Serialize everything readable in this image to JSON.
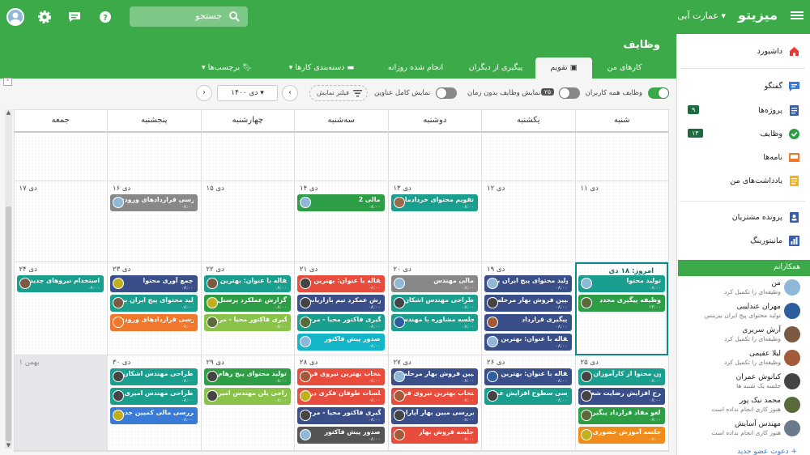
{
  "topbar": {
    "brand": "میزیتو",
    "workspace": "عمارت آبی",
    "search_placeholder": "جستجو"
  },
  "sidebar": {
    "items": [
      {
        "label": "داشبورد",
        "icon": "home-icon",
        "color": "#e53935"
      },
      {
        "label": "گفتگو",
        "icon": "chat-icon",
        "color": "#3a7bd5"
      },
      {
        "label": "پروژه‌ها",
        "icon": "projects-icon",
        "color": "#3a5fa8",
        "badge": "۹"
      },
      {
        "label": "وظایف",
        "icon": "tasks-icon",
        "color": "#2e9e46",
        "badge": "۱۳"
      },
      {
        "label": "نامه‌ها",
        "icon": "mail-icon",
        "color": "#f0772b"
      },
      {
        "label": "یادداشت‌های من",
        "icon": "notes-icon",
        "color": "#f3b21c"
      },
      {
        "label": "پرونده مشتریان",
        "icon": "customers-icon",
        "color": "#3a5fa8"
      },
      {
        "label": "مانیتورینگ",
        "icon": "monitoring-icon",
        "color": "#3a5fa8"
      }
    ],
    "colleagues_header": "همکارانم",
    "colleagues": [
      {
        "name": "من",
        "status": "وظیفه‌ای را تکمیل کرد",
        "color": "#8fb8d8"
      },
      {
        "name": "مهران عندلیبی",
        "status": "تولید محتوای پیج ایران بیزینس",
        "color": "#2d5e9e"
      },
      {
        "name": "آرش سریری",
        "status": "وظیفه‌ای را تکمیل کرد",
        "color": "#7a5a40"
      },
      {
        "name": "لیلا عقیمی",
        "status": "وظیفه‌ای را تکمیل کرد",
        "color": "#a35a3a"
      },
      {
        "name": "کیانوش عمران",
        "status": "جلسه یک شنبه ها",
        "color": "#444"
      },
      {
        "name": "محمد نیک پور",
        "status": "هنوز کاری انجام نداده است",
        "color": "#5a6a3a"
      },
      {
        "name": "مهندس آسایش",
        "status": "هنوز کاری انجام نداده است",
        "color": "#6a7a8a"
      }
    ],
    "invite_label": "دعوت عضو جدید +"
  },
  "main": {
    "title": "وظایف",
    "tabs": [
      {
        "label": "کارهای من",
        "active": false
      },
      {
        "label": "تقویم",
        "active": true
      },
      {
        "label": "پیگیری از دیگران",
        "active": false
      },
      {
        "label": "انجام شده روزانه",
        "active": false
      },
      {
        "label": "دسته‌بندی کارها",
        "active": false
      },
      {
        "label": "برچسب‌ها",
        "active": false
      }
    ]
  },
  "filters": {
    "all_users_label": "وظایف همه کاربران",
    "no_time_label": "نمایش وظایف بدون زمان",
    "no_time_count": "۲۵",
    "full_titles_label": "نمایش کامل عناوین",
    "filter_button": "فیلتر نمایش",
    "current_month": "دی ۱۴۰۰"
  },
  "calendar": {
    "days": [
      "شنبه",
      "یکشنبه",
      "دوشنبه",
      "سه‌شنبه",
      "چهارشنبه",
      "پنجشنبه",
      "جمعه"
    ],
    "weeks": [
      {
        "dates": [
          "",
          "",
          "",
          "",
          "",
          "",
          ""
        ]
      },
      {
        "dates": [
          "۱۱ دی",
          "۱۲ دی",
          "۱۳ دی",
          "۱۴ دی",
          "۱۵ دی",
          "۱۶ دی",
          "۱۷ دی"
        ]
      },
      {
        "dates": [
          "امروز: ۱۸ دی",
          "۱۹ دی",
          "۲۰ دی",
          "۲۱ دی",
          "۲۲ دی",
          "۲۳ دی",
          "۲۴ دی"
        ]
      },
      {
        "dates": [
          "۲۵ دی",
          "۲۶ دی",
          "۲۷ دی",
          "۲۸ دی",
          "۲۹ دی",
          "۳۰ دی",
          "۱ بهمن"
        ]
      }
    ],
    "tasks": [
      {
        "w": 1,
        "d": 2,
        "row": 0,
        "title": "تقویم محتوای خردادماه",
        "time": "۰۸:۰۰",
        "color": "#1a9e8e",
        "av": "#9a6a4a"
      },
      {
        "w": 1,
        "d": 3,
        "row": 0,
        "title": "مالی 2",
        "time": "۰۸:۰۰",
        "color": "#2e9e46",
        "av": "#8fb8d8"
      },
      {
        "w": 1,
        "d": 5,
        "row": 0,
        "title": "بررسی قراردادهای ورودی",
        "time": "۰۸:۰۰",
        "color": "#888888",
        "av": "#8fb8d8"
      },
      {
        "w": 2,
        "d": 0,
        "row": 0,
        "title": "تولید محتوا",
        "time": "۰۸:۰۰",
        "color": "#1a9e8e",
        "av": "#8fb8d8"
      },
      {
        "w": 2,
        "d": 0,
        "row": 1,
        "title": "وظیفه پیگیری مجدد",
        "time": "۱۳:۰۰",
        "color": "#2e9e46",
        "av": "#5a6a3a"
      },
      {
        "w": 2,
        "d": 1,
        "row": 0,
        "title": "تولید محتوای پیج ایران بیـ...",
        "time": "۰۸:۰۰",
        "color": "#3a4f8a",
        "av": "#8fb8d8"
      },
      {
        "w": 2,
        "d": 1,
        "row": 1,
        "title": "کمپین فروش بهار مرحله ا...",
        "time": "۰۸:۰۰",
        "color": "#3a4f8a",
        "av": "#444"
      },
      {
        "w": 2,
        "d": 1,
        "row": 2,
        "title": "پیگیری قرارداد",
        "time": "۰۸:۰۰",
        "color": "#3a4f8a",
        "av": "#a35a3a"
      },
      {
        "w": 2,
        "d": 1,
        "row": 3,
        "title": "مقاله با عنوان: بهترین را...",
        "time": "۰۸:۰۰",
        "color": "#3a4f8a",
        "av": "#8fb8d8"
      },
      {
        "w": 2,
        "d": 2,
        "row": 0,
        "title": "مالی مهندس",
        "time": "۰۸:۰۰",
        "color": "#888888",
        "av": "#8fb8d8"
      },
      {
        "w": 2,
        "d": 2,
        "row": 1,
        "title": "طراحی مهندس اشکان",
        "time": "۰۸:۰۰",
        "color": "#1a9e8e",
        "av": "#444"
      },
      {
        "w": 2,
        "d": 2,
        "row": 2,
        "title": "جلسه مشاوره با مهندس ...",
        "time": "۰۸:۰۰",
        "color": "#1a9e8e",
        "av": "#2d5e9e"
      },
      {
        "w": 2,
        "d": 3,
        "row": 0,
        "title": "مقاله با عنوان: بهترین را...",
        "time": "۰۸:۰۰",
        "color": "#e84c3d",
        "av": "#444"
      },
      {
        "w": 2,
        "d": 3,
        "row": 1,
        "title": "گزارش عمکرد تیم بازاریابی",
        "time": "۰۸:۰۰",
        "color": "#3a4f8a",
        "av": "#444"
      },
      {
        "w": 2,
        "d": 3,
        "row": 2,
        "title": "پیگیری فاکتور محیا - مرحـ...",
        "time": "۰۸:۰۰",
        "color": "#1a9e8e",
        "av": "#5a6a3a"
      },
      {
        "w": 2,
        "d": 3,
        "row": 3,
        "title": "صدور پیش فاکتور",
        "time": "۰۸:۰۰",
        "color": "#13b5c8",
        "av": "#8fb8d8"
      },
      {
        "w": 2,
        "d": 4,
        "row": 0,
        "title": "مقاله با عنوان: بهترین را...",
        "time": "۰۸:۰۰",
        "color": "#1a9e8e",
        "av": "#7a5a40"
      },
      {
        "w": 2,
        "d": 4,
        "row": 1,
        "title": "گزارش عملکرد پرسنل",
        "time": "۰۸:۰۰",
        "color": "#2e9e46",
        "av": "#c0b020"
      },
      {
        "w": 2,
        "d": 4,
        "row": 2,
        "title": "پیگیری فاکتور محیا - مرحـ...",
        "time": "۰۸:۰۰",
        "color": "#8bc34a",
        "av": "#5a6a3a"
      },
      {
        "w": 2,
        "d": 5,
        "row": 0,
        "title": "جمع آوری محتوا",
        "time": "۰۸:۰۰",
        "color": "#3a4f8a",
        "av": "#c0b020"
      },
      {
        "w": 2,
        "d": 5,
        "row": 1,
        "title": "تولید محتوای پیج ایران بیز...",
        "time": "۰۸:۰۰",
        "color": "#1a9e8e",
        "av": "#7a5a40"
      },
      {
        "w": 2,
        "d": 5,
        "row": 2,
        "title": "بررسی قراردادهای ورودی",
        "time": "۰۸:۰۰",
        "color": "#f0772b",
        "av": "#f0772b"
      },
      {
        "w": 2,
        "d": 6,
        "row": 0,
        "title": "استخدام نیروهای جدید",
        "time": "۰۸:۰۰",
        "color": "#1a9e8e",
        "av": "#7a5a40"
      },
      {
        "w": 3,
        "d": 0,
        "row": 0,
        "title": "آزمون محتوا از کارآموزان ج...",
        "time": "۰۸:۰۰",
        "color": "#1a9e8e",
        "av": "#444"
      },
      {
        "w": 3,
        "d": 0,
        "row": 1,
        "title": "طرح افزایش رضایت شغلـ...",
        "time": "۰۸:۰۰",
        "color": "#3a4f8a",
        "av": "#444"
      },
      {
        "w": 3,
        "d": 0,
        "row": 2,
        "title": "لغو مفاد قرارداد پیگیری ...",
        "time": "۰۸:۰۰",
        "color": "#2e9e46",
        "av": "#5a6a3a"
      },
      {
        "w": 3,
        "d": 0,
        "row": 3,
        "title": "جلسه آموزش حضوری",
        "time": "۰۸:۰۰",
        "color": "#f08c1b",
        "av": "#c0b020"
      },
      {
        "w": 3,
        "d": 1,
        "row": 0,
        "title": "مقاله با عنوان: بهترین را...",
        "time": "۰۸:۰۰",
        "color": "#3a4f8a",
        "av": "#2d5e9e"
      },
      {
        "w": 3,
        "d": 1,
        "row": 1,
        "title": "بررسی سطوح افزایش عما...",
        "time": "۰۸:۰۰",
        "color": "#1a9e8e",
        "av": "#444"
      },
      {
        "w": 3,
        "d": 2,
        "row": 0,
        "title": "کمپین فروش بهار مرحله ا...",
        "time": "۰۸:۰۰",
        "color": "#3a4f8a",
        "av": "#8fb8d8"
      },
      {
        "w": 3,
        "d": 2,
        "row": 1,
        "title": "انتخاب بهترین نیروی فرو...",
        "time": "۰۸:۰۰",
        "color": "#e84c3d",
        "av": "#a35a3a"
      },
      {
        "w": 3,
        "d": 2,
        "row": 2,
        "title": "بررسی مبین بهار آپارات",
        "time": "۰۸:۰۰",
        "color": "#3a4f8a",
        "av": "#444"
      },
      {
        "w": 3,
        "d": 2,
        "row": 3,
        "title": "جلسه فروش بهار",
        "time": "۰۸:۰۰",
        "color": "#e84c3d",
        "av": "#a35a3a"
      },
      {
        "w": 3,
        "d": 3,
        "row": 0,
        "title": "انتخاب بهترین نیروی فرو...",
        "time": "۰۸:۰۰",
        "color": "#e84c3d",
        "av": "#a35a3a"
      },
      {
        "w": 3,
        "d": 3,
        "row": 1,
        "title": "جلسات طوفان فکری درو...",
        "time": "۰۸:۰۰",
        "color": "#e84c3d",
        "av": "#c0b020"
      },
      {
        "w": 3,
        "d": 3,
        "row": 2,
        "title": "پیگیری فاکتور محیا - مرحـ...",
        "time": "۰۸:۰۰",
        "color": "#3a4f8a",
        "av": "#444"
      },
      {
        "w": 3,
        "d": 3,
        "row": 3,
        "title": "صدور پیش فاکتور",
        "time": "۰۸:۰۰",
        "color": "#555555",
        "av": "#8fb8d8"
      },
      {
        "w": 3,
        "d": 4,
        "row": 0,
        "title": "تولید محتوای پیج رهام",
        "time": "۰۸:۰۰",
        "color": "#2e9e46",
        "av": "#444"
      },
      {
        "w": 3,
        "d": 4,
        "row": 1,
        "title": "طراحی پلن مهندس امیری",
        "time": "۰۸:۰۰",
        "color": "#8bc34a",
        "av": "#444"
      },
      {
        "w": 3,
        "d": 5,
        "row": 0,
        "title": "طراحی مهندس اشکان",
        "time": "۰۸:۰۰",
        "color": "#1a9e8e",
        "av": "#444"
      },
      {
        "w": 3,
        "d": 5,
        "row": 1,
        "title": "طراحی مهندس امیری",
        "time": "۰۸:۰۰",
        "color": "#1a9e8e",
        "av": "#444"
      },
      {
        "w": 3,
        "d": 5,
        "row": 2,
        "title": "بررسی مالی کمپین جدید ...",
        "time": "۰۸:۰۰",
        "color": "#3a7bd5",
        "av": "#c0b020"
      }
    ]
  }
}
